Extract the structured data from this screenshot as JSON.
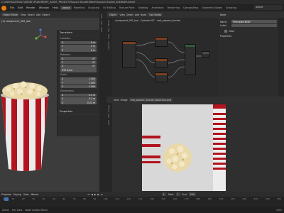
{
  "window_title": "C:\\USERS\\DEFAULT\\DESKTOP\\WORK\\MY_ASSET_PROJECT\\Popcorn Bucket\\Work\\Popcorn Bucket_BLENDER.blend",
  "menu": [
    "File",
    "Edit",
    "Render",
    "Window",
    "Help"
  ],
  "workspaces": [
    "Layout",
    "Modeling",
    "Sculpting",
    "UV Editing",
    "Texture Paint",
    "Shading",
    "Animation",
    "Rendering",
    "Compositing",
    "Geometry Nodes",
    "Scripting"
  ],
  "active_workspace": "Layout",
  "scene_name": "Scene",
  "viewport": {
    "object_label": "(1) component_002_low",
    "header_items": [
      "Object Mode",
      "View",
      "Select",
      "Add",
      "Object"
    ]
  },
  "npanel": {
    "section_transform": "Transform",
    "location_label": "Location:",
    "location": [
      {
        "axis": "X",
        "value": "0 m"
      },
      {
        "axis": "Y",
        "value": "0 m"
      },
      {
        "axis": "Z",
        "value": "0 m"
      }
    ],
    "rotation_label": "Rotation:",
    "rotation": [
      {
        "axis": "X",
        "value": "0°"
      },
      {
        "axis": "Y",
        "value": "0°"
      },
      {
        "axis": "Z",
        "value": "0°"
      }
    ],
    "rotation_mode": "XYZ Euler",
    "scale_label": "Scale:",
    "scale": [
      {
        "axis": "X",
        "value": "1.000"
      },
      {
        "axis": "Y",
        "value": "1.000"
      },
      {
        "axis": "Z",
        "value": "1.000"
      }
    ],
    "dimensions_label": "Dimensions:",
    "dimensions": [
      {
        "axis": "X",
        "value": "0.2 m"
      },
      {
        "axis": "Y",
        "value": "0.2 m"
      },
      {
        "axis": "Z",
        "value": "0.21 m"
      }
    ],
    "section_properties": "Properties",
    "tabs": [
      "Item",
      "Tool",
      "View"
    ]
  },
  "node_editor": {
    "header_items": [
      "Object",
      "View",
      "Select",
      "Add",
      "Node",
      "Use Nodes"
    ],
    "breadcrumb": [
      "component_002_low",
      "Cylinder.007",
      "mat_popcorn_bucket"
    ],
    "tabs": [
      "Node",
      "Tool",
      "View",
      "Options"
    ]
  },
  "image_editor": {
    "header_items": [
      "View",
      "Image"
    ],
    "image_name": "mat_popcorn_bucket_BaseColor.png",
    "tabs": [
      "Image",
      "Tool",
      "View"
    ]
  },
  "properties": {
    "section": "Node",
    "name_label": "Name",
    "name_value": "Principled BSDF",
    "label_label": "Label",
    "color_label": "Color",
    "section_properties": "Properties"
  },
  "timeline": {
    "header_items": [
      "Playback",
      "Keying",
      "View",
      "Marker"
    ],
    "current_frame": "1",
    "start_label": "Start",
    "start": "1",
    "end_label": "End",
    "end": "250",
    "ticks": [
      "0",
      "10",
      "20",
      "30",
      "40",
      "50",
      "60",
      "70",
      "80",
      "90",
      "100",
      "110",
      "120",
      "130",
      "140",
      "150",
      "160",
      "170",
      "180",
      "190",
      "200",
      "210",
      "220",
      "230",
      "240",
      "250"
    ]
  },
  "status": {
    "select": "Select",
    "pan": "Pan View",
    "context": "Node Context Menu",
    "version": "3.6.0"
  },
  "colors": {
    "accent": "#e87d0d",
    "bucket_red": "#b1141e",
    "popcorn": "#e9d8a8",
    "selected_orange": "#f29a2e"
  }
}
